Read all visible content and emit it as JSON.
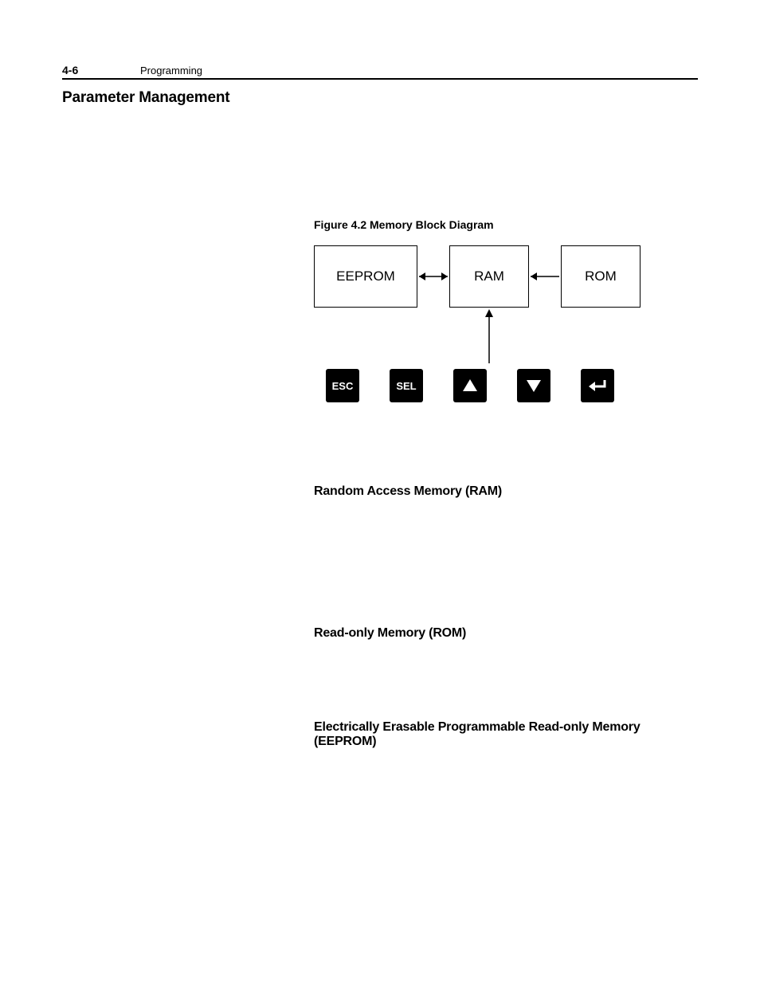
{
  "header": {
    "page_number": "4-6",
    "chapter": "Programming"
  },
  "heading": "Parameter Management",
  "figure": {
    "caption": "Figure 4.2   Memory Block Diagram",
    "blocks": {
      "eeprom": "EEPROM",
      "ram": "RAM",
      "rom": "ROM"
    },
    "keys": {
      "esc": "ESC",
      "sel": "SEL"
    }
  },
  "sections": {
    "ram": "Random Access Memory (RAM)",
    "rom": "Read-only Memory (ROM)",
    "eeprom": "Electrically Erasable Programmable Read-only Memory (EEPROM)"
  }
}
